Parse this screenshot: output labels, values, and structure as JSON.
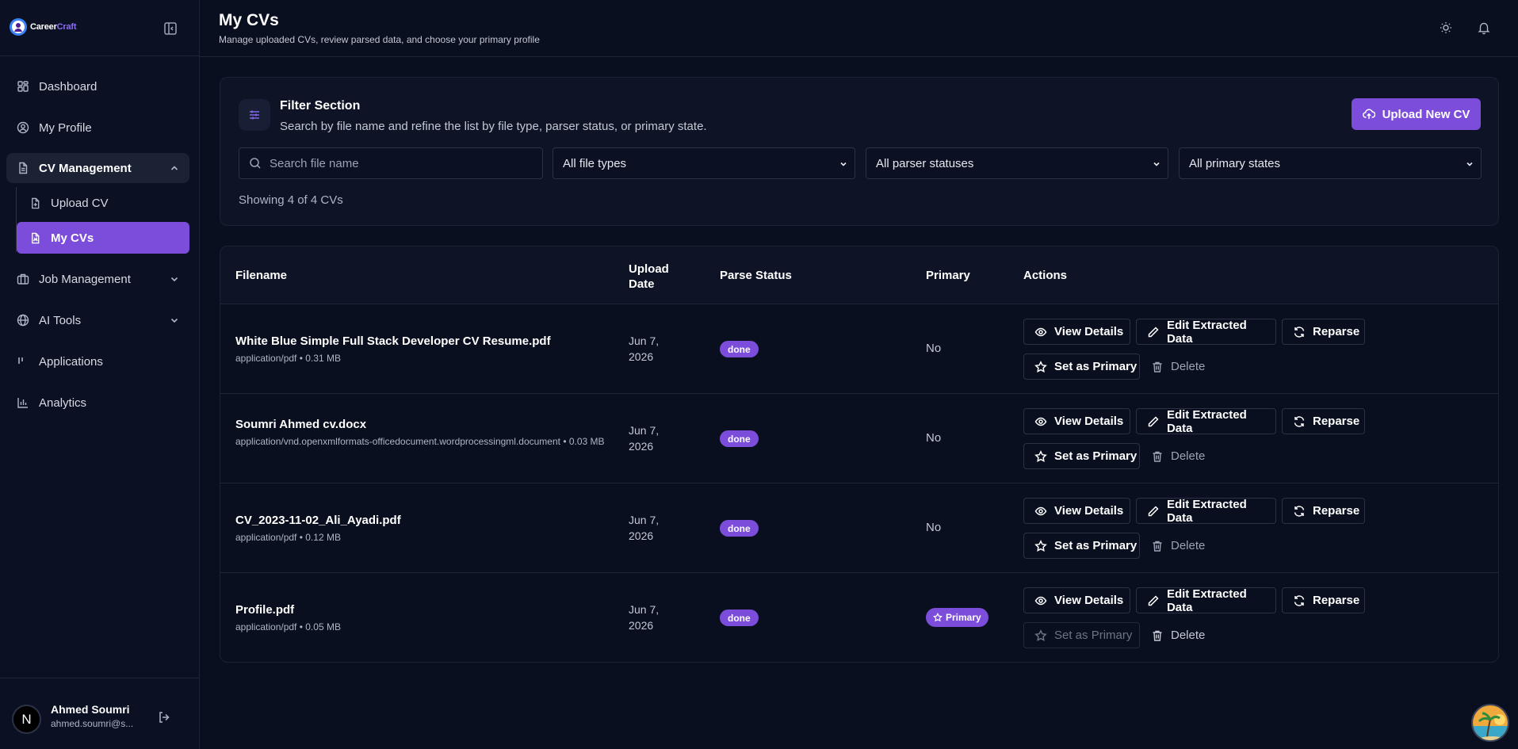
{
  "brand": {
    "name_part1": "Career",
    "name_part2": "Craft",
    "accent_color": "#7c4ddb"
  },
  "sidebar": {
    "items": [
      {
        "label": "Dashboard",
        "icon": "grid-icon"
      },
      {
        "label": "My Profile",
        "icon": "user-circle-icon"
      },
      {
        "label": "CV Management",
        "icon": "file-icon",
        "expanded": true
      },
      {
        "label": "Job Management",
        "icon": "briefcase-icon"
      },
      {
        "label": "AI Tools",
        "icon": "globe-icon"
      },
      {
        "label": "Applications",
        "icon": "bars-icon"
      },
      {
        "label": "Analytics",
        "icon": "chart-icon"
      }
    ],
    "sub_items": [
      {
        "label": "Upload CV",
        "icon": "file-plus-icon"
      },
      {
        "label": "My CVs",
        "icon": "file-text-icon",
        "active": true
      }
    ],
    "user": {
      "initial": "N",
      "name": "Ahmed Soumri",
      "email": "ahmed.soumri@s..."
    }
  },
  "header": {
    "title": "My CVs",
    "subtitle": "Manage uploaded CVs, review parsed data, and choose your primary profile"
  },
  "filter": {
    "title": "Filter Section",
    "description": "Search by file name and refine the list by file type, parser status, or primary state.",
    "upload_label": "Upload New CV",
    "search_placeholder": "Search file name",
    "file_type": "All file types",
    "parser_status": "All parser statuses",
    "primary_state": "All primary states",
    "showing": "Showing 4 of 4 CVs"
  },
  "table": {
    "headers": {
      "filename": "Filename",
      "upload_date_1": "Upload",
      "upload_date_2": "Date",
      "parse_status": "Parse Status",
      "primary": "Primary",
      "actions": "Actions"
    },
    "actions": {
      "view": "View Details",
      "edit": "Edit Extracted Data",
      "reparse": "Reparse",
      "set_primary": "Set as Primary",
      "delete": "Delete"
    },
    "rows": [
      {
        "filename": "White Blue Simple Full Stack Developer CV Resume.pdf",
        "meta": "application/pdf • 0.31 MB",
        "date_1": "Jun 7,",
        "date_2": "2026",
        "status": "done",
        "primary": "No"
      },
      {
        "filename": "Soumri Ahmed cv.docx",
        "meta": "application/vnd.openxmlformats-officedocument.wordprocessingml.document • 0.03 MB",
        "date_1": "Jun 7,",
        "date_2": "2026",
        "status": "done",
        "primary": "No"
      },
      {
        "filename": "CV_2023-11-02_Ali_Ayadi.pdf",
        "meta": "application/pdf • 0.12 MB",
        "date_1": "Jun 7,",
        "date_2": "2026",
        "status": "done",
        "primary": "No"
      },
      {
        "filename": "Profile.pdf",
        "meta": "application/pdf • 0.05 MB",
        "date_1": "Jun 7,",
        "date_2": "2026",
        "status": "done",
        "primary": "Primary"
      }
    ]
  }
}
